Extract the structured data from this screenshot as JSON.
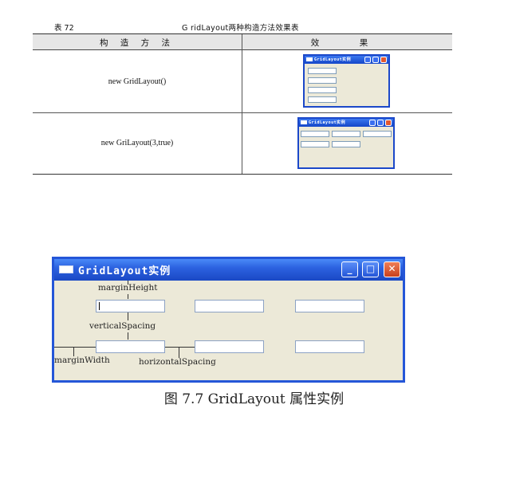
{
  "table": {
    "number": "表 72",
    "title": "G ridLayout两种构造方法效果表",
    "headers": [
      "构 造 方 法",
      "效　果"
    ],
    "rows": [
      {
        "method": "new GridLayout()",
        "window_title": "GridLayout实例"
      },
      {
        "method": "new GriLayout(3,true)",
        "window_title": "GridLayout实例"
      }
    ]
  },
  "figure": {
    "window_title": "GridLayout实例",
    "labels": {
      "margin_height": "marginHeight",
      "vertical_spacing": "verticalSpacing",
      "margin_width": "marginWidth",
      "horizontal_spacing": "horizontalSpacing"
    },
    "caption": "图 7.7    GridLayout 属性实例"
  },
  "colors": {
    "titlebar_blue": "#2456d8",
    "window_bg": "#ece9d8",
    "close_red": "#d94a23"
  }
}
